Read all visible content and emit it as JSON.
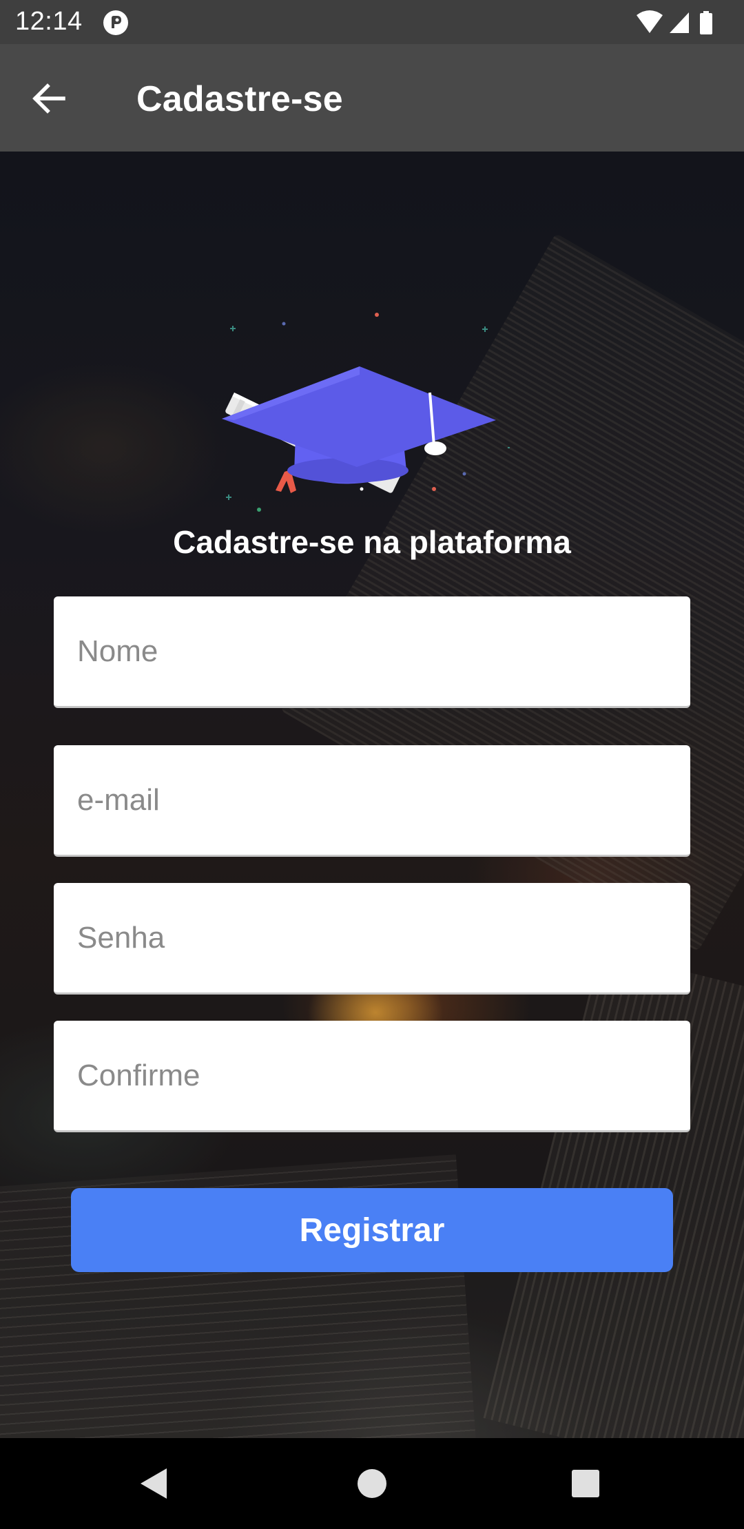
{
  "status_bar": {
    "time": "12:14",
    "icons": [
      "app-notification-icon",
      "wifi-icon",
      "signal-icon",
      "battery-icon"
    ]
  },
  "app_bar": {
    "title": "Cadastre-se",
    "back_icon": "arrow-back-icon"
  },
  "main": {
    "logo_icon": "graduation-cap-icon",
    "headline": "Cadastre-se na plataforma",
    "fields": [
      {
        "placeholder": "Nome",
        "value": ""
      },
      {
        "placeholder": "e-mail",
        "value": ""
      },
      {
        "placeholder": "Senha",
        "value": ""
      },
      {
        "placeholder": "Confirme",
        "value": ""
      }
    ],
    "submit_label": "Registrar"
  },
  "nav_bar": {
    "icons": [
      "back-triangle-icon",
      "home-circle-icon",
      "recents-square-icon"
    ]
  },
  "colors": {
    "status_bar": "#3f3f3f",
    "app_bar": "#494949",
    "button": "#4a80f5",
    "cap": "#5a5ae0"
  }
}
